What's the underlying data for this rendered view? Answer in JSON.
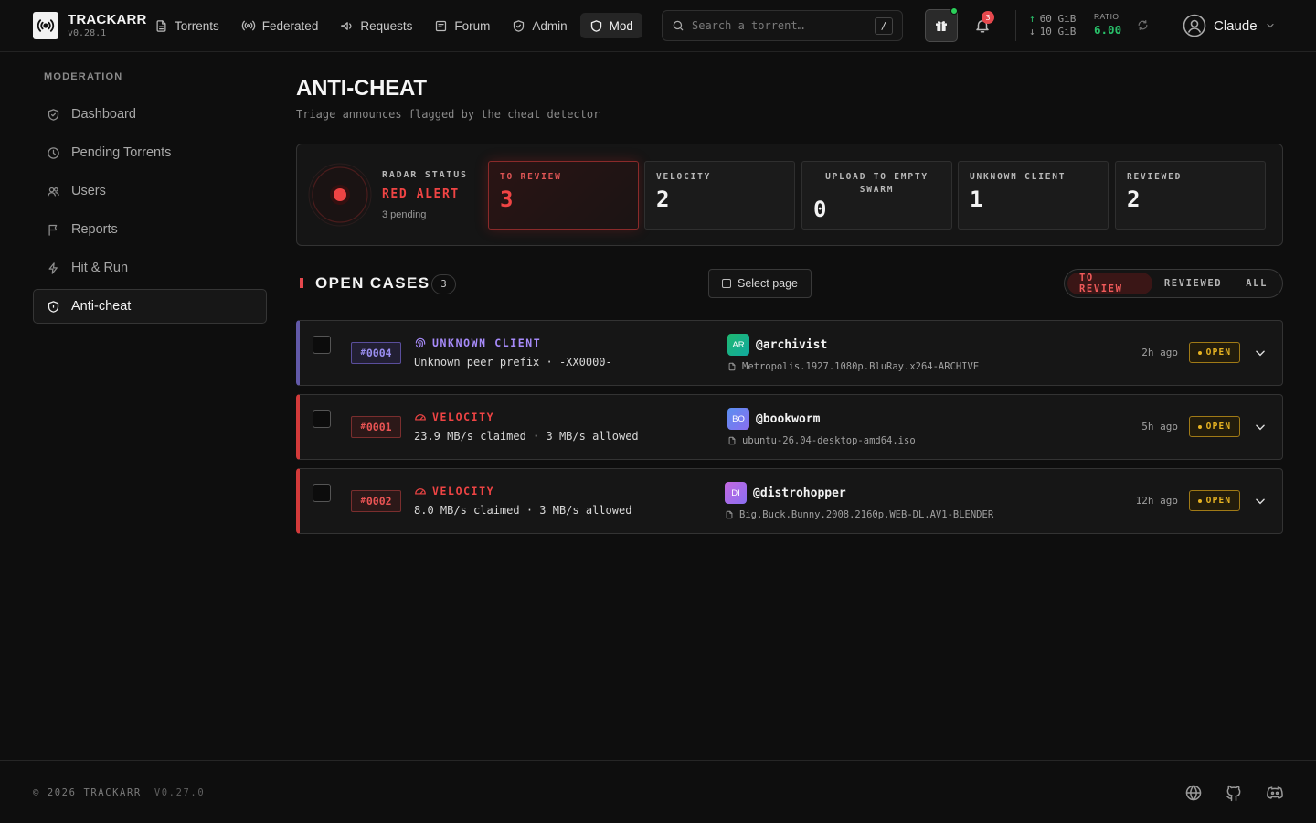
{
  "brand": {
    "name": "TRACKARR",
    "version": "v0.28.1"
  },
  "nav": [
    {
      "label": "Torrents",
      "icon": "file-icon"
    },
    {
      "label": "Federated",
      "icon": "broadcast-icon"
    },
    {
      "label": "Requests",
      "icon": "megaphone-icon"
    },
    {
      "label": "Forum",
      "icon": "message-icon"
    },
    {
      "label": "Admin",
      "icon": "shield-icon"
    },
    {
      "label": "Mod",
      "icon": "shield-icon",
      "active": true
    }
  ],
  "search": {
    "placeholder": "Search a torrent…",
    "shortcut": "/"
  },
  "notifications": {
    "count": "3"
  },
  "transfer": {
    "upload": "60 GiB",
    "download": "10 GiB",
    "ratio_label": "RATIO",
    "ratio": "6.00"
  },
  "user": {
    "name": "Claude"
  },
  "sidebar": {
    "heading": "MODERATION",
    "items": [
      {
        "label": "Dashboard",
        "icon": "shield-check-icon"
      },
      {
        "label": "Pending Torrents",
        "icon": "clock-icon"
      },
      {
        "label": "Users",
        "icon": "users-icon"
      },
      {
        "label": "Reports",
        "icon": "flag-icon"
      },
      {
        "label": "Hit & Run",
        "icon": "zap-icon"
      },
      {
        "label": "Anti-cheat",
        "icon": "shield-icon",
        "active": true
      }
    ]
  },
  "page": {
    "title": "ANTI-CHEAT",
    "subtitle": "Triage announces flagged by the cheat detector"
  },
  "radar": {
    "label": "RADAR STATUS",
    "status": "RED ALERT",
    "pending": "3 pending"
  },
  "stats": [
    {
      "label": "TO REVIEW",
      "value": "3"
    },
    {
      "label": "VELOCITY",
      "value": "2"
    },
    {
      "label": "UPLOAD TO EMPTY SWARM",
      "value": "0"
    },
    {
      "label": "UNKNOWN CLIENT",
      "value": "1"
    },
    {
      "label": "REVIEWED",
      "value": "2"
    }
  ],
  "cases_header": {
    "title": "OPEN CASES",
    "count": "3",
    "select_page": "Select page"
  },
  "filter_tabs": [
    "TO REVIEW",
    "REVIEWED",
    "ALL"
  ],
  "cases": [
    {
      "id": "0004",
      "type": "UNKNOWN CLIENT",
      "description": "Unknown peer prefix · -XX0000-",
      "avatar": "AR",
      "user": "@archivist",
      "file": "Metropolis.1927.1080p.BluRay.x264-ARCHIVE",
      "time": "2h ago",
      "status": "OPEN"
    },
    {
      "id": "0001",
      "type": "VELOCITY",
      "description": "23.9 MB/s claimed · 3 MB/s allowed",
      "avatar": "BO",
      "user": "@bookworm",
      "file": "ubuntu-26.04-desktop-amd64.iso",
      "time": "5h ago",
      "status": "OPEN"
    },
    {
      "id": "0002",
      "type": "VELOCITY",
      "description": "8.0 MB/s claimed · 3 MB/s allowed",
      "avatar": "DI",
      "user": "@distrohopper",
      "file": "Big.Buck.Bunny.2008.2160p.WEB-DL.AV1-BLENDER",
      "time": "12h ago",
      "status": "OPEN"
    }
  ],
  "footer": {
    "copyright": "© 2026 TRACKARR",
    "version": "V0.27.0"
  },
  "colors": {
    "accent_red": "#ef4444",
    "accent_purple": "#a78bfa",
    "open_amber": "#e8b422",
    "ratio_green": "#29c06a"
  }
}
